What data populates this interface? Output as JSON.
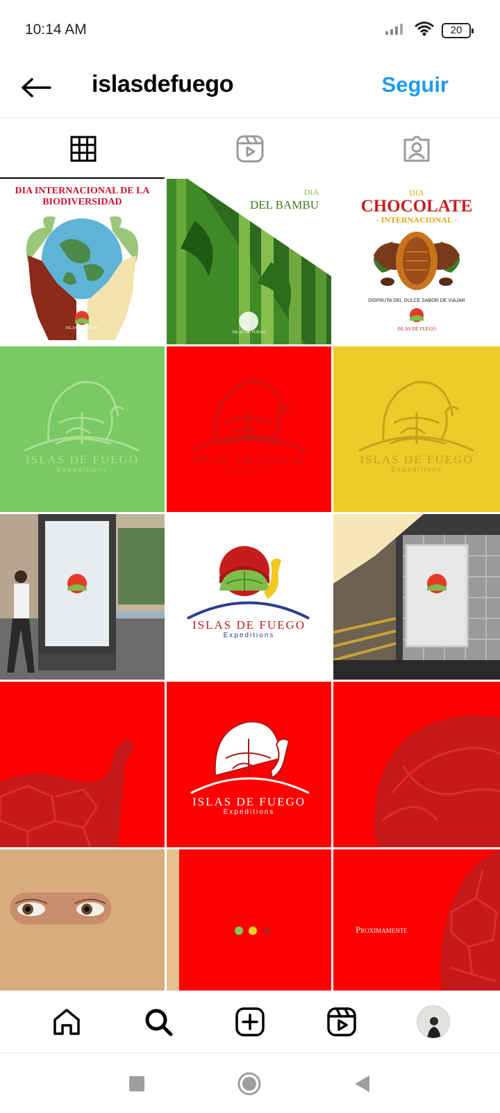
{
  "status_bar": {
    "time": "10:14 AM",
    "battery": "20"
  },
  "header": {
    "username": "islasdefuego",
    "follow_label": "Seguir"
  },
  "tabs": [
    {
      "name": "grid",
      "icon": "grid-icon",
      "active": true
    },
    {
      "name": "reels",
      "icon": "reels-icon",
      "active": false
    },
    {
      "name": "tagged",
      "icon": "tagged-icon",
      "active": false
    }
  ],
  "posts": {
    "biodiversity": {
      "title": "DIA INTERNACIONAL DE LA BIODIVERSIDAD",
      "brand": "ISLAS DE FUEGO"
    },
    "bamboo": {
      "line1": "DIA",
      "line2": "DEL BAMBU",
      "brand": "ISLAS DE FUEGO"
    },
    "chocolate": {
      "line1": "DIA",
      "line2": "CHOCOLATE",
      "line3": "- INTERNACIONAL -",
      "caption": "DISFRUTA DEL DULCE SABOR DE VIAJAR",
      "brand": "ISLAS DE FUEGO"
    },
    "logo_brand": "ISLAS DE FUEGO",
    "logo_sub": "Expeditions",
    "coming_soon": "Proximamente"
  },
  "colors": {
    "accent": "#1d9bf0",
    "brand_red": "#ff0000",
    "brand_green": "#79c965",
    "brand_yellow": "#eccb2a"
  },
  "bottom_nav": [
    "home-icon",
    "search-icon",
    "create-icon",
    "reels-icon",
    "profile-avatar"
  ],
  "system_nav": [
    "recents-button",
    "home-button",
    "back-button"
  ]
}
